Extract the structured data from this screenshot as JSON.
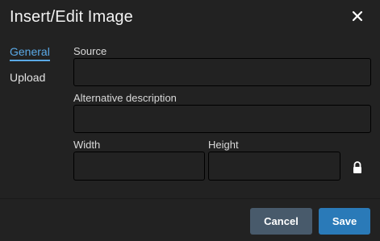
{
  "dialog": {
    "title": "Insert/Edit Image",
    "close_icon": "close-icon"
  },
  "tabs": [
    {
      "label": "General",
      "active": true
    },
    {
      "label": "Upload",
      "active": false
    }
  ],
  "fields": {
    "source": {
      "label": "Source",
      "value": ""
    },
    "alt": {
      "label": "Alternative description",
      "value": ""
    },
    "width": {
      "label": "Width",
      "value": ""
    },
    "height": {
      "label": "Height",
      "value": ""
    }
  },
  "lock_icon": "lock-icon",
  "buttons": {
    "cancel": "Cancel",
    "save": "Save"
  },
  "colors": {
    "background": "#222222",
    "accent": "#5aa9e6",
    "save_button": "#2a7ab8",
    "cancel_button": "#485a6b"
  }
}
